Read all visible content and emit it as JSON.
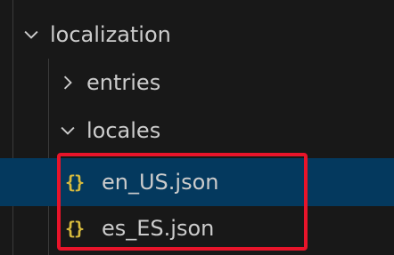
{
  "explorer": {
    "items": [
      {
        "label": "localization",
        "kind": "folder",
        "expanded": true,
        "icon": "chevron-down-icon"
      },
      {
        "label": "entries",
        "kind": "folder",
        "expanded": false,
        "icon": "chevron-right-icon"
      },
      {
        "label": "locales",
        "kind": "folder",
        "expanded": true,
        "icon": "chevron-down-icon"
      },
      {
        "label": "en_US.json",
        "kind": "file",
        "selected": true,
        "icon": "json-file-icon",
        "glyph": "{}"
      },
      {
        "label": "es_ES.json",
        "kind": "file",
        "selected": false,
        "icon": "json-file-icon",
        "glyph": "{}"
      }
    ],
    "colors": {
      "background": "#181818",
      "selection": "#04395e",
      "json_icon": "#d7ba3d",
      "highlight_box": "#e8142a"
    }
  }
}
